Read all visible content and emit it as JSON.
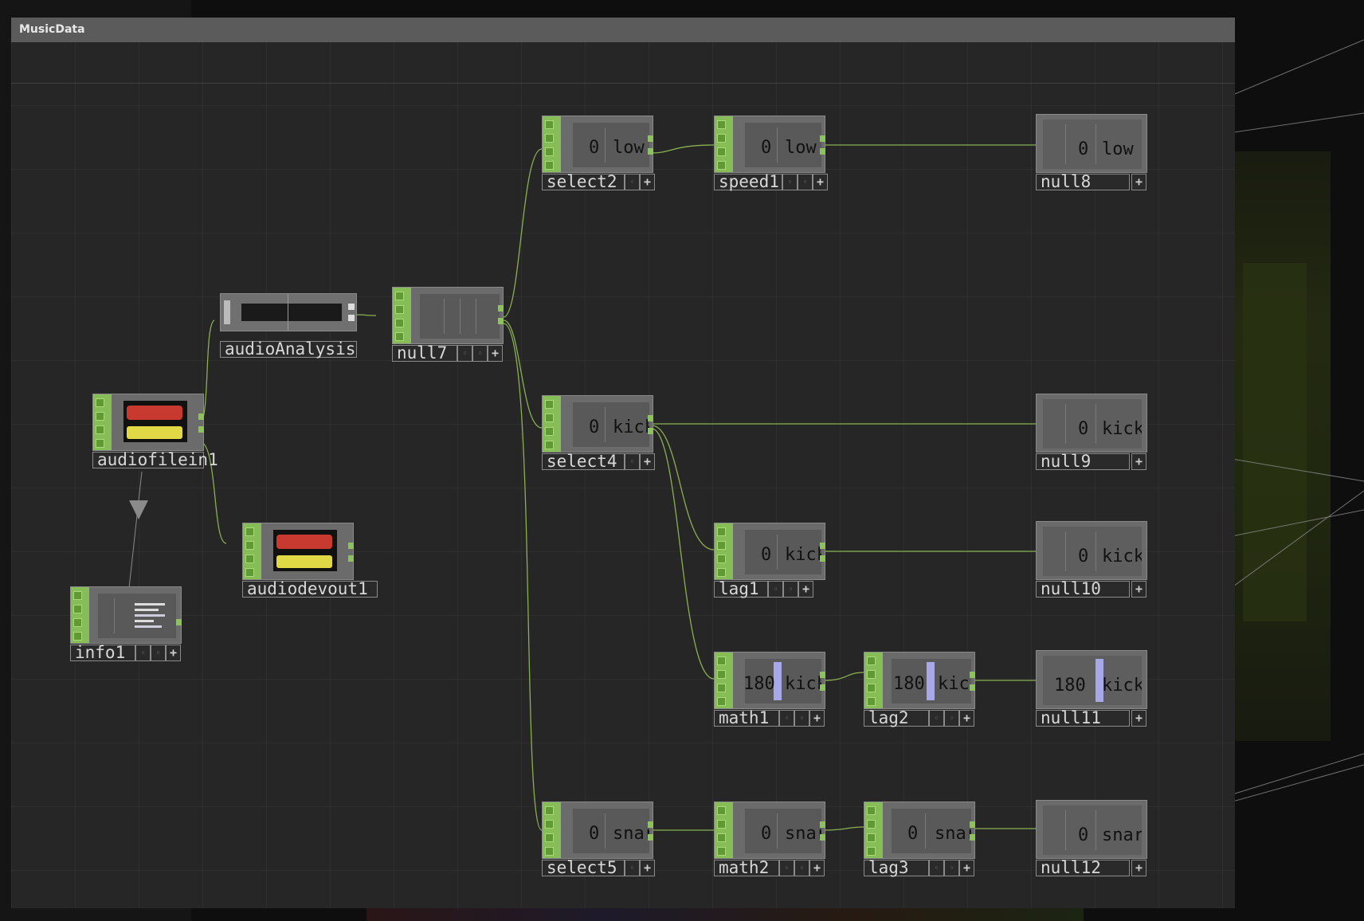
{
  "window": {
    "title": "MusicData"
  },
  "colors": {
    "wire": "#8ab050",
    "input_strip": "#86bd56",
    "node_bg": "#6b6b6b",
    "panel_bg": "#262626",
    "header_bg": "#5b5b5b"
  },
  "nodes": {
    "select2": {
      "name": "select2",
      "value": "0",
      "channel": "low"
    },
    "speed1": {
      "name": "speed1",
      "value": "0",
      "channel": "low"
    },
    "null8": {
      "name": "null8",
      "value": "0",
      "channel": "low"
    },
    "audioAnalysis": {
      "name": "audioAnalysis"
    },
    "null7": {
      "name": "null7"
    },
    "audiofilein1": {
      "name": "audiofilein1"
    },
    "select4": {
      "name": "select4",
      "value": "0",
      "channel": "kick"
    },
    "null9": {
      "name": "null9",
      "value": "0",
      "channel": "kick"
    },
    "audiodevout1": {
      "name": "audiodevout1"
    },
    "lag1": {
      "name": "lag1",
      "value": "0",
      "channel": "kick"
    },
    "null10": {
      "name": "null10",
      "value": "0",
      "channel": "kick"
    },
    "info1": {
      "name": "info1"
    },
    "math1": {
      "name": "math1",
      "value": "180",
      "channel": "kick"
    },
    "lag2": {
      "name": "lag2",
      "value": "180",
      "channel": "kick"
    },
    "null11": {
      "name": "null11",
      "value": "180",
      "channel": "kick"
    },
    "select5": {
      "name": "select5",
      "value": "0",
      "channel": "snare"
    },
    "math2": {
      "name": "math2",
      "value": "0",
      "channel": "snare"
    },
    "lag3": {
      "name": "lag3",
      "value": "0",
      "channel": "snare"
    },
    "null12": {
      "name": "null12",
      "value": "0",
      "channel": "snare"
    }
  }
}
